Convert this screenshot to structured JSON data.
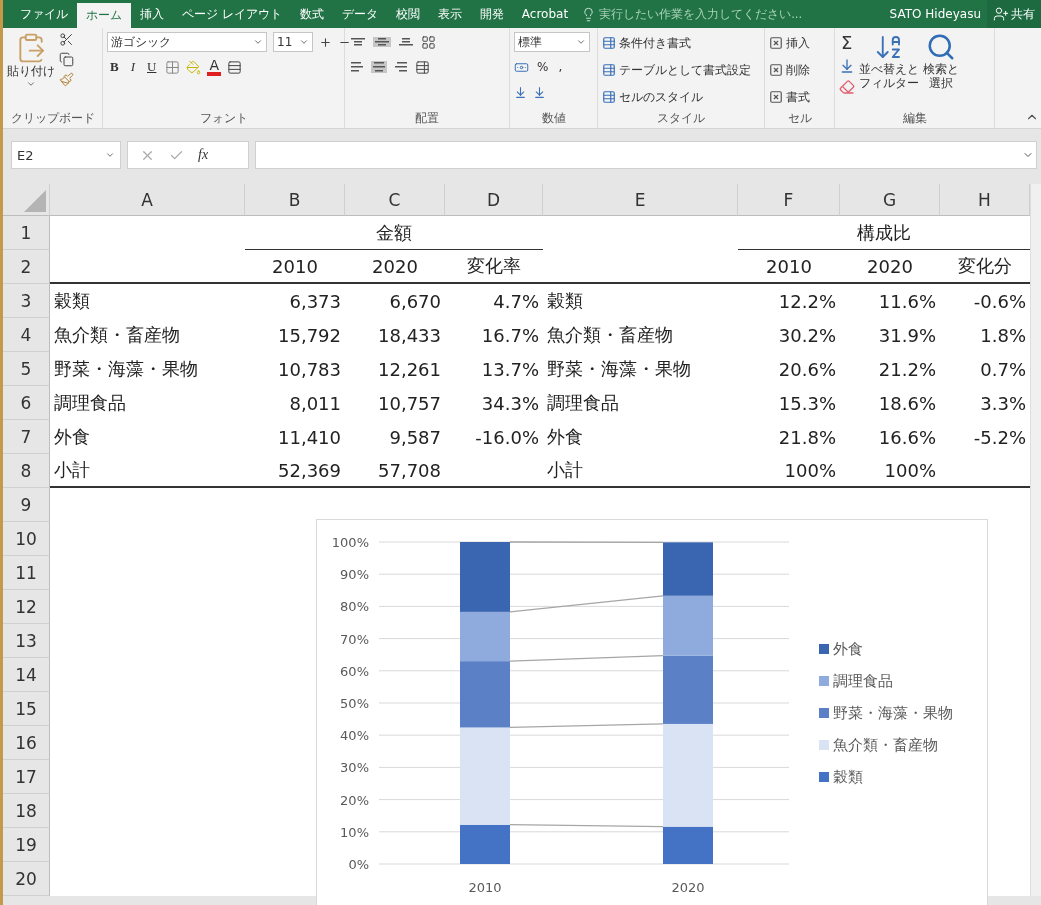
{
  "title_bar": {
    "tabs": [
      {
        "label": "ファイル",
        "selected": false
      },
      {
        "label": "ホーム",
        "selected": true
      },
      {
        "label": "挿入",
        "selected": false
      },
      {
        "label": "ページ レイアウト",
        "selected": false
      },
      {
        "label": "数式",
        "selected": false
      },
      {
        "label": "データ",
        "selected": false
      },
      {
        "label": "校閲",
        "selected": false
      },
      {
        "label": "表示",
        "selected": false
      },
      {
        "label": "開発",
        "selected": false
      },
      {
        "label": "Acrobat",
        "selected": false
      }
    ],
    "tell_me": {
      "placeholder": "実行したい作業を入力してください..."
    },
    "user": "SATO Hideyasu",
    "share": "共有"
  },
  "ribbon": {
    "clipboard": {
      "paste": "貼り付け",
      "label": "クリップボード"
    },
    "font": {
      "font_name": "游ゴシック",
      "font_size": "11",
      "bold": "B",
      "italic": "I",
      "underline": "U",
      "font_color": "A",
      "label": "フォント"
    },
    "alignment": {
      "label": "配置",
      "vertical": [
        {
          "kind": "top",
          "selected": false
        },
        {
          "kind": "middle",
          "selected": true
        },
        {
          "kind": "bottom",
          "selected": false
        }
      ],
      "horizontal": [
        {
          "kind": "left",
          "selected": false
        },
        {
          "kind": "center",
          "selected": true
        },
        {
          "kind": "right",
          "selected": false
        }
      ]
    },
    "number": {
      "format": "標準",
      "percent": "%",
      "comma": ",",
      "label": "数値"
    },
    "styles": {
      "commands": [
        "条件付き書式",
        "テーブルとして書式設定",
        "セルのスタイル"
      ],
      "label": "スタイル"
    },
    "cells": {
      "commands": [
        "挿入",
        "削除",
        "書式"
      ],
      "label": "セル"
    },
    "editing": {
      "autosum": "Σ",
      "sort": [
        "並べ替えと",
        "フィルター"
      ],
      "find": [
        "検索と",
        "選択"
      ],
      "label": "編集"
    }
  },
  "formula_bar": {
    "name_box": "E2",
    "function_label": "fx"
  },
  "sheet": {
    "columns": [
      "A",
      "B",
      "C",
      "D",
      "E",
      "F",
      "G",
      "H"
    ],
    "row_numbers": [
      "1",
      "2",
      "3",
      "4",
      "5",
      "6",
      "7",
      "8",
      "9",
      "10",
      "11",
      "12",
      "13",
      "14",
      "15",
      "16",
      "17",
      "18",
      "19",
      "20"
    ],
    "rows": [
      {
        "kind": "group",
        "cells": {
          "B": "金額",
          "F": "構成比"
        }
      },
      {
        "kind": "header",
        "cells": {
          "B": "2010",
          "C": "2020",
          "D": "変化率",
          "F": "2010",
          "G": "2020",
          "H": "変化分"
        }
      },
      {
        "kind": "data",
        "cells": {
          "A": "穀類",
          "B": "6,373",
          "C": "6,670",
          "D": "4.7%",
          "E": "穀類",
          "F": "12.2%",
          "G": "11.6%",
          "H": "-0.6%"
        }
      },
      {
        "kind": "data",
        "cells": {
          "A": "魚介類・畜産物",
          "B": "15,792",
          "C": "18,433",
          "D": "16.7%",
          "E": "魚介類・畜産物",
          "F": "30.2%",
          "G": "31.9%",
          "H": "1.8%"
        }
      },
      {
        "kind": "data",
        "cells": {
          "A": "野菜・海藻・果物",
          "B": "10,783",
          "C": "12,261",
          "D": "13.7%",
          "E": "野菜・海藻・果物",
          "F": "20.6%",
          "G": "21.2%",
          "H": "0.7%"
        }
      },
      {
        "kind": "data",
        "cells": {
          "A": "調理食品",
          "B": "8,011",
          "C": "10,757",
          "D": "34.3%",
          "E": "調理食品",
          "F": "15.3%",
          "G": "18.6%",
          "H": "3.3%"
        }
      },
      {
        "kind": "data",
        "cells": {
          "A": "外食",
          "B": "11,410",
          "C": "9,587",
          "D": "-16.0%",
          "E": "外食",
          "F": "21.8%",
          "G": "16.6%",
          "H": "-5.2%"
        }
      },
      {
        "kind": "total",
        "cells": {
          "A": "小計",
          "B": "52,369",
          "C": "57,708",
          "E": "小計",
          "F": "100%",
          "G": "100%"
        }
      }
    ],
    "chart": {
      "chart_data": {
        "type": "bar",
        "stacked": true,
        "orientation": "vertical",
        "grid": true,
        "legend": true,
        "categories": [
          "2010",
          "2020"
        ],
        "series": [
          {
            "name": "穀類",
            "color": "#4472c4",
            "values": [
              12.2,
              11.6
            ]
          },
          {
            "name": "魚介類・畜産物",
            "color": "#dae3f3",
            "values": [
              30.2,
              31.9
            ]
          },
          {
            "name": "野菜・海藻・果物",
            "color": "#5b80c6",
            "values": [
              20.6,
              21.2
            ]
          },
          {
            "name": "調理食品",
            "color": "#8faadc",
            "values": [
              15.3,
              18.6
            ]
          },
          {
            "name": "外食",
            "color": "#3a65b0",
            "values": [
              21.8,
              16.6
            ]
          }
        ],
        "ylim": [
          0,
          100
        ],
        "yticks": [
          {
            "value": 0,
            "label": "0%"
          },
          {
            "value": 10,
            "label": "10%"
          },
          {
            "value": 20,
            "label": "20%"
          },
          {
            "value": 30,
            "label": "30%"
          },
          {
            "value": 40,
            "label": "40%"
          },
          {
            "value": 50,
            "label": "50%"
          },
          {
            "value": 60,
            "label": "60%"
          },
          {
            "value": 70,
            "label": "70%"
          },
          {
            "value": 80,
            "label": "80%"
          },
          {
            "value": 90,
            "label": "90%"
          },
          {
            "value": 100,
            "label": "100%"
          }
        ]
      }
    }
  }
}
